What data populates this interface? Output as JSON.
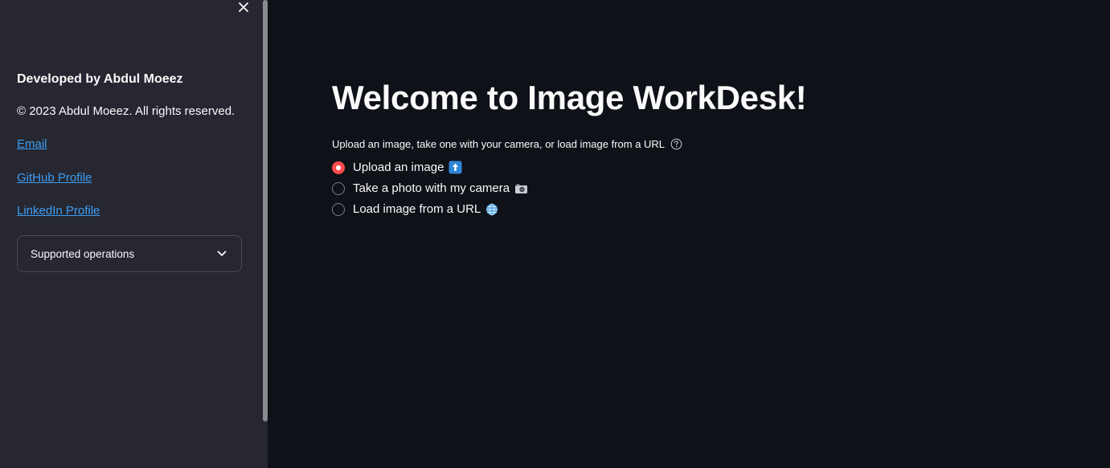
{
  "sidebar": {
    "heading": "Developed by Abdul Moeez",
    "copyright": "© 2023 Abdul Moeez. All rights reserved.",
    "links": [
      {
        "label": "Email"
      },
      {
        "label": "GitHub Profile"
      },
      {
        "label": "LinkedIn Profile"
      }
    ],
    "expander": {
      "label": "Supported operations",
      "expanded": false
    }
  },
  "main": {
    "title": "Welcome to Image WorkDesk!",
    "radio_group": {
      "label": "Upload an image, take one with your camera, or load image from a URL",
      "options": [
        {
          "label": "Upload an image",
          "icon": "up-arrow-emoji-icon",
          "selected": true
        },
        {
          "label": "Take a photo with my camera",
          "icon": "camera-emoji-icon",
          "selected": false
        },
        {
          "label": "Load image from a URL",
          "icon": "globe-emoji-icon",
          "selected": false
        }
      ]
    }
  },
  "colors": {
    "background": "#0e1117",
    "sidebar_background": "#262730",
    "accent": "#ff4b4b",
    "link": "#3d9df3",
    "text": "#fafafa"
  }
}
